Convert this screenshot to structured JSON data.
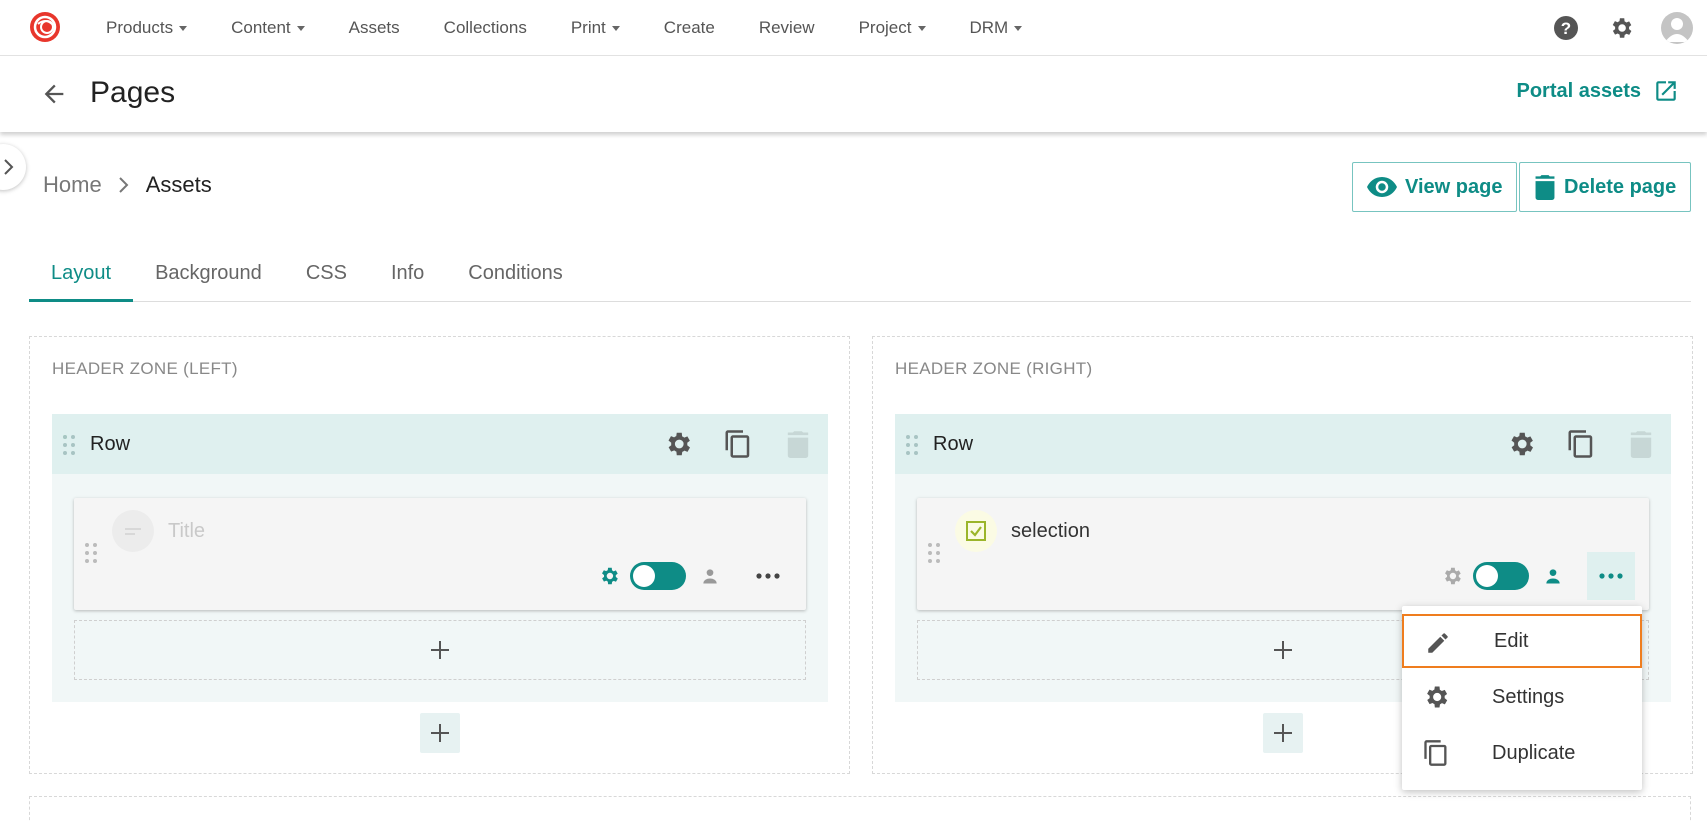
{
  "nav": {
    "items": [
      {
        "label": "Products",
        "dropdown": true
      },
      {
        "label": "Content",
        "dropdown": true
      },
      {
        "label": "Assets",
        "dropdown": false
      },
      {
        "label": "Collections",
        "dropdown": false
      },
      {
        "label": "Print",
        "dropdown": true
      },
      {
        "label": "Create",
        "dropdown": false
      },
      {
        "label": "Review",
        "dropdown": false
      },
      {
        "label": "Project",
        "dropdown": true
      },
      {
        "label": "DRM",
        "dropdown": true
      }
    ],
    "icons": [
      "help-icon",
      "gear-icon",
      "user-avatar-icon"
    ]
  },
  "header": {
    "title": "Pages",
    "portal_link": "Portal assets"
  },
  "breadcrumb": {
    "home": "Home",
    "current": "Assets"
  },
  "actions": {
    "view_page": "View page",
    "delete_page": "Delete page"
  },
  "tabs": [
    {
      "label": "Layout",
      "active": true
    },
    {
      "label": "Background",
      "active": false
    },
    {
      "label": "CSS",
      "active": false
    },
    {
      "label": "Info",
      "active": false
    },
    {
      "label": "Conditions",
      "active": false
    }
  ],
  "zones": {
    "left": {
      "title": "HEADER ZONE (LEFT)",
      "row_label": "Row",
      "widget": {
        "name": "Title",
        "enabled": true
      }
    },
    "right": {
      "title": "HEADER ZONE (RIGHT)",
      "row_label": "Row",
      "widget": {
        "name": "selection",
        "enabled": true
      }
    }
  },
  "context_menu": {
    "items": [
      {
        "label": "Edit",
        "icon": "pencil-icon"
      },
      {
        "label": "Settings",
        "icon": "gear-icon"
      },
      {
        "label": "Duplicate",
        "icon": "copy-icon"
      }
    ]
  },
  "colors": {
    "accent": "#0e8c86",
    "row_header": "#dff0ef",
    "menu_highlight": "#ef7d1e",
    "logo": "#e8362c"
  }
}
